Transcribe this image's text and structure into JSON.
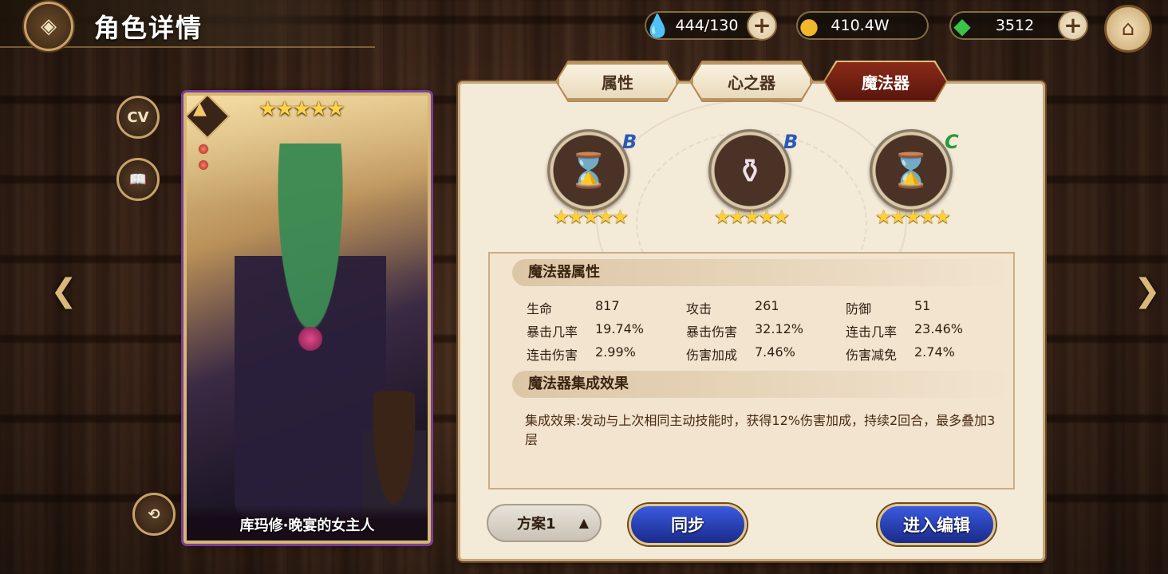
{
  "header": {
    "title": "角色详情"
  },
  "currencies": [
    {
      "name": "stamina",
      "icon": "water-drop-icon",
      "value": "444/130",
      "color": "#2a8adf"
    },
    {
      "name": "gold",
      "icon": "gold-coin-icon",
      "value": "410.4W",
      "color": "#e8b32a"
    },
    {
      "name": "gems",
      "icon": "green-crystal-icon",
      "value": "3512",
      "color": "#3ac24a"
    }
  ],
  "side_buttons": {
    "cv_label": "CV"
  },
  "card": {
    "name": "库玛修·晚宴的女主人",
    "stars": "★★★★★"
  },
  "tabs": [
    {
      "label": "属性",
      "active": false
    },
    {
      "label": "心之器",
      "active": false
    },
    {
      "label": "魔法器",
      "active": true
    }
  ],
  "slots": [
    {
      "grade": "B",
      "grade_color": "#2a5ab8",
      "stars": "★★★★★",
      "item_icon": "hourglass-icon"
    },
    {
      "grade": "B",
      "grade_color": "#2a5ab8",
      "stars": "★★★★★",
      "item_icon": "potion-flask-icon"
    },
    {
      "grade": "C",
      "grade_color": "#2a9a3a",
      "stars": "★★★★★",
      "item_icon": "hourglass-icon"
    }
  ],
  "attributes": {
    "header": "魔法器属性",
    "stats": [
      {
        "label": "生命",
        "value": "817"
      },
      {
        "label": "攻击",
        "value": "261"
      },
      {
        "label": "防御",
        "value": "51"
      },
      {
        "label": "暴击几率",
        "value": "19.74%"
      },
      {
        "label": "暴击伤害",
        "value": "32.12%"
      },
      {
        "label": "连击几率",
        "value": "23.46%"
      },
      {
        "label": "连击伤害",
        "value": "2.99%"
      },
      {
        "label": "伤害加成",
        "value": "7.46%"
      },
      {
        "label": "伤害减免",
        "value": "2.74%"
      }
    ]
  },
  "set_effect": {
    "header": "魔法器集成效果",
    "text": "集成效果:发动与上次相同主动技能时，获得12%伤害加成，持续2回合，最多叠加3层"
  },
  "bottom": {
    "plan_label": "方案1",
    "sync_label": "同步",
    "edit_label": "进入编辑"
  }
}
